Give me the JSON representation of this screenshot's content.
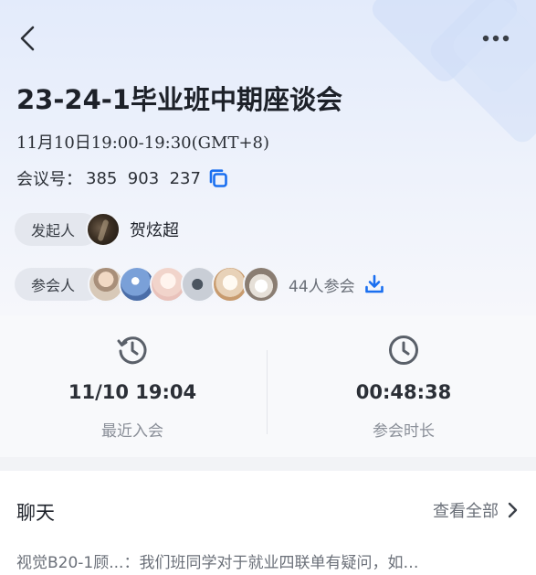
{
  "header": {
    "title": "23-24-1毕业班中期座谈会",
    "time": "11月10日19:00-19:30(GMT+8)",
    "meeting_id_label": "会议号：",
    "meeting_id": "385  903  237"
  },
  "host": {
    "label": "发起人",
    "name": "贺炫超"
  },
  "participants": {
    "label": "参会人",
    "count_text": "44人参会"
  },
  "stats": {
    "last_join": {
      "value": "11/10 19:04",
      "caption": "最近入会"
    },
    "duration": {
      "value": "00:48:38",
      "caption": "参会时长"
    }
  },
  "chat": {
    "title": "聊天",
    "see_all": "查看全部",
    "preview": "视觉B20-1顾...：我们班同学对于就业四联单有疑问，如…"
  },
  "colors": {
    "accent": "#1a6ff0",
    "title": "#1d2129",
    "muted": "#8a8f98"
  }
}
